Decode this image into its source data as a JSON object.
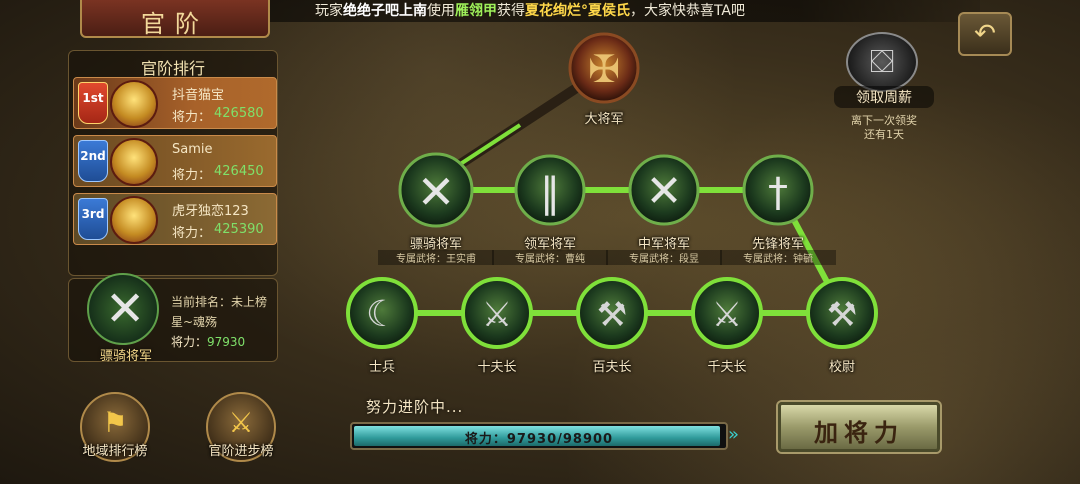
{
  "banner": {
    "p1": "玩家",
    "player": "绝绝子吧上南",
    "p2": "使用",
    "item": "雁翎甲",
    "p3": "获得",
    "reward": "夏花绚烂°夏侯氏",
    "p4": "，大家快恭喜TA吧"
  },
  "header": {
    "title": "官阶"
  },
  "ranking": {
    "title": "官阶排行",
    "power_label": "将力：",
    "entries": [
      {
        "badge": "1st",
        "name": "抖音猫宝",
        "power": "426580"
      },
      {
        "badge": "2nd",
        "name": "Samie",
        "power": "426450"
      },
      {
        "badge": "3rd",
        "name": "虎牙独恋123",
        "power": "425390"
      }
    ]
  },
  "self": {
    "rank_name": "骠骑将军",
    "current_rank_line": "当前排名：未上榜",
    "name": "星~魂殇",
    "power_label": "将力：",
    "power": "97930"
  },
  "bottom_buttons": {
    "region": "地域排行榜",
    "progress": "官阶进步榜"
  },
  "salary": {
    "label": "领取周薪",
    "note_1": "离下一次领奖",
    "note_2": "还有1天"
  },
  "tree": {
    "top": {
      "label": "大将军"
    },
    "generals": [
      {
        "label": "骠骑将军",
        "sub": "专属武将：王实甫"
      },
      {
        "label": "领军将军",
        "sub": "专属武将：曹纯"
      },
      {
        "label": "中军将军",
        "sub": "专属武将：段昱"
      },
      {
        "label": "先锋将军",
        "sub": "专属武将：钟毓"
      }
    ],
    "soldiers": [
      {
        "label": "士兵"
      },
      {
        "label": "十夫长"
      },
      {
        "label": "百夫长"
      },
      {
        "label": "千夫长"
      },
      {
        "label": "校尉"
      }
    ]
  },
  "progress": {
    "caption": "努力进阶中...",
    "text": "将力：97930/98900",
    "current": 97930,
    "max": 98900
  },
  "actions": {
    "boost": "加将力"
  },
  "colors": {
    "line_active": "#7fe03a",
    "line_inactive": "#4a3b25",
    "accent": "#f2c64a"
  }
}
